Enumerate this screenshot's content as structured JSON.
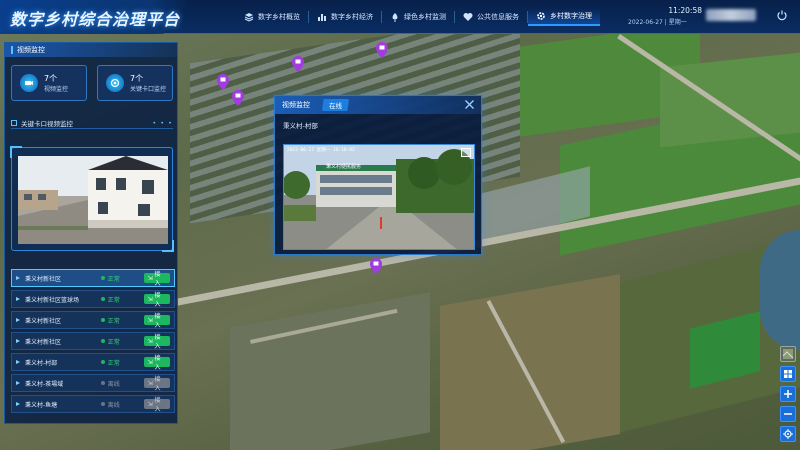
{
  "header": {
    "app_title": "数字乡村综合治理平台",
    "nav": [
      {
        "label": "数字乡村概览",
        "icon": "layers-icon",
        "active": false
      },
      {
        "label": "数字乡村经济",
        "icon": "bar-chart-icon",
        "active": false
      },
      {
        "label": "绿色乡村监测",
        "icon": "leaf-icon",
        "active": false
      },
      {
        "label": "公共信息服务",
        "icon": "heart-icon",
        "active": false
      },
      {
        "label": "乡村数字治理",
        "icon": "settings-icon",
        "active": true
      }
    ],
    "time": "11:20:58",
    "date": "2022-06-27 | 星期一"
  },
  "left_panel": {
    "title": "视频监控",
    "stats": [
      {
        "value": "7个",
        "label": "视频监控",
        "icon": "camera-icon"
      },
      {
        "value": "7个",
        "label": "关键卡口监控",
        "icon": "checkpoint-icon"
      }
    ],
    "section_title": "关键卡口视频监控",
    "cameras": [
      {
        "name": "秉义村新社区",
        "status": "正常",
        "action": "接入",
        "online": true,
        "selected": true
      },
      {
        "name": "秉义村新社区篮球场",
        "status": "正常",
        "action": "接入",
        "online": true,
        "selected": false
      },
      {
        "name": "秉义村新社区",
        "status": "正常",
        "action": "接入",
        "online": true,
        "selected": false
      },
      {
        "name": "秉义村新社区",
        "status": "正常",
        "action": "接入",
        "online": true,
        "selected": false
      },
      {
        "name": "秉义村-村部",
        "status": "正常",
        "action": "接入",
        "online": true,
        "selected": false
      },
      {
        "name": "秉义村-茶場域",
        "status": "离线",
        "action": "接入",
        "online": false,
        "selected": false
      },
      {
        "name": "秉义村-鱼塘",
        "status": "离线",
        "action": "接入",
        "online": false,
        "selected": false
      }
    ]
  },
  "popup": {
    "title": "视频监控",
    "badge": "在线",
    "subtitle": "秉义村-村部",
    "osd": "2022-06-27 星期一 16:18:02",
    "sign": "秉义村便民服务"
  },
  "colors": {
    "accent": "#1e7ee0",
    "online_green": "#1bb85f",
    "offline_gray": "#6b7585",
    "pin_purple": "#a23be0"
  }
}
